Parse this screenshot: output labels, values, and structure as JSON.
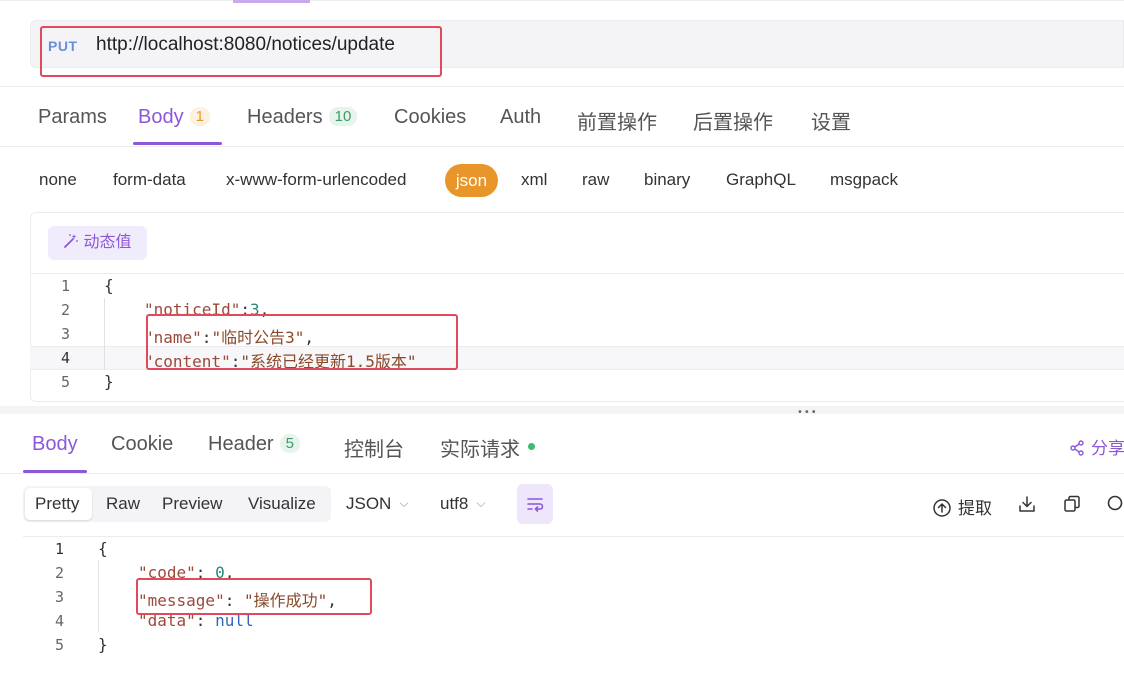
{
  "request": {
    "method": "PUT",
    "url": "http://localhost:8080/notices/update",
    "tabs": [
      {
        "label": "Params"
      },
      {
        "label": "Body",
        "badge": "1"
      },
      {
        "label": "Headers",
        "badge": "10"
      },
      {
        "label": "Cookies"
      },
      {
        "label": "Auth"
      },
      {
        "label": "前置操作"
      },
      {
        "label": "后置操作"
      },
      {
        "label": "设置"
      }
    ],
    "body_types": [
      "none",
      "form-data",
      "x-www-form-urlencoded",
      "json",
      "xml",
      "raw",
      "binary",
      "GraphQL",
      "msgpack"
    ],
    "active_body_type": "json",
    "dynamic_value_label": "动态值",
    "code_lines": [
      {
        "n": "1",
        "text": "{"
      },
      {
        "n": "2",
        "key": "\"noticeId\"",
        "sep": ":",
        "val": "3",
        "end": ","
      },
      {
        "n": "3",
        "key": "\"name\"",
        "sep": ":",
        "val": "\"临时公告3\"",
        "end": ","
      },
      {
        "n": "4",
        "key": "\"content\"",
        "sep": ":",
        "val": "\"系统已经更新1.5版本\"",
        "end": ""
      },
      {
        "n": "5",
        "text": "}"
      }
    ]
  },
  "response": {
    "tabs": [
      {
        "label": "Body"
      },
      {
        "label": "Cookie"
      },
      {
        "label": "Header",
        "badge": "5"
      },
      {
        "label": "控制台"
      },
      {
        "label": "实际请求"
      }
    ],
    "share_label": "分享",
    "view_modes": [
      "Pretty",
      "Raw",
      "Preview",
      "Visualize"
    ],
    "format": "JSON",
    "encoding": "utf8",
    "extract_label": "提取",
    "code_lines": [
      {
        "n": "1",
        "text": "{"
      },
      {
        "n": "2",
        "key": "\"code\"",
        "sep": ": ",
        "val": "0",
        "end": ","
      },
      {
        "n": "3",
        "key": "\"message\"",
        "sep": ": ",
        "val": "\"操作成功\"",
        "end": ","
      },
      {
        "n": "4",
        "key": "\"data\"",
        "sep": ": ",
        "val": "null",
        "end": ""
      },
      {
        "n": "5",
        "text": "}"
      }
    ]
  },
  "colors": {
    "accent": "#8c57d9",
    "json_pill": "#e8962a",
    "highlight_box": "#e04a5c",
    "status_dot": "#3dbb6d"
  }
}
